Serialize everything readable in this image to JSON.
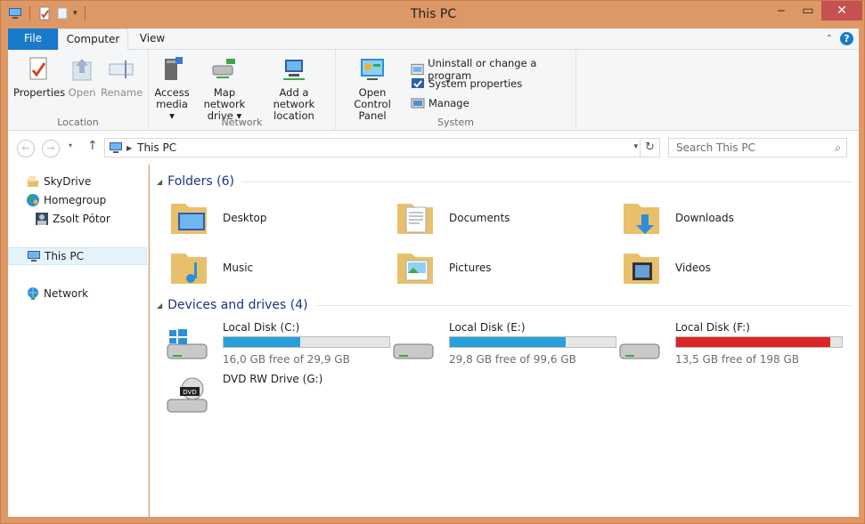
{
  "window": {
    "title": "This PC"
  },
  "ribbon_tabs": {
    "file": "File",
    "computer": "Computer",
    "view": "View"
  },
  "ribbon": {
    "location": {
      "label": "Location",
      "properties": "Properties",
      "open": "Open",
      "rename": "Rename"
    },
    "network": {
      "label": "Network",
      "access_media": [
        "Access",
        "media ▾"
      ],
      "map_drive": [
        "Map network",
        "drive ▾"
      ],
      "add_location": [
        "Add a network",
        "location"
      ]
    },
    "system": {
      "label": "System",
      "open_cp": [
        "Open Control",
        "Panel"
      ],
      "uninstall": "Uninstall or change a program",
      "sysprops": "System properties",
      "manage": "Manage"
    }
  },
  "address": {
    "crumb": "This PC",
    "search_placeholder": "Search This PC"
  },
  "nav": {
    "skydrive": "SkyDrive",
    "homegroup": "Homegroup",
    "user": "Zsolt Pótor",
    "thispc": "This PC",
    "network": "Network"
  },
  "folders": {
    "header": "Folders (6)",
    "items": [
      "Desktop",
      "Documents",
      "Downloads",
      "Music",
      "Pictures",
      "Videos"
    ]
  },
  "drives": {
    "header": "Devices and drives (4)",
    "items": [
      {
        "name": "Local Disk (C:)",
        "free": "16,0 GB free of 29,9 GB",
        "used_fraction": 0.46
      },
      {
        "name": "Local Disk (E:)",
        "free": "29,8 GB free of 99,6 GB",
        "used_fraction": 0.7
      },
      {
        "name": "Local Disk (F:)",
        "free": "13,5 GB free of 198 GB",
        "used_fraction": 0.93
      },
      {
        "name": "DVD RW Drive (G:)"
      }
    ]
  },
  "colors": {
    "accent": "#1979ca",
    "bar_normal": "#26a0da",
    "bar_full": "#da2626",
    "frame": "#dd9866"
  }
}
